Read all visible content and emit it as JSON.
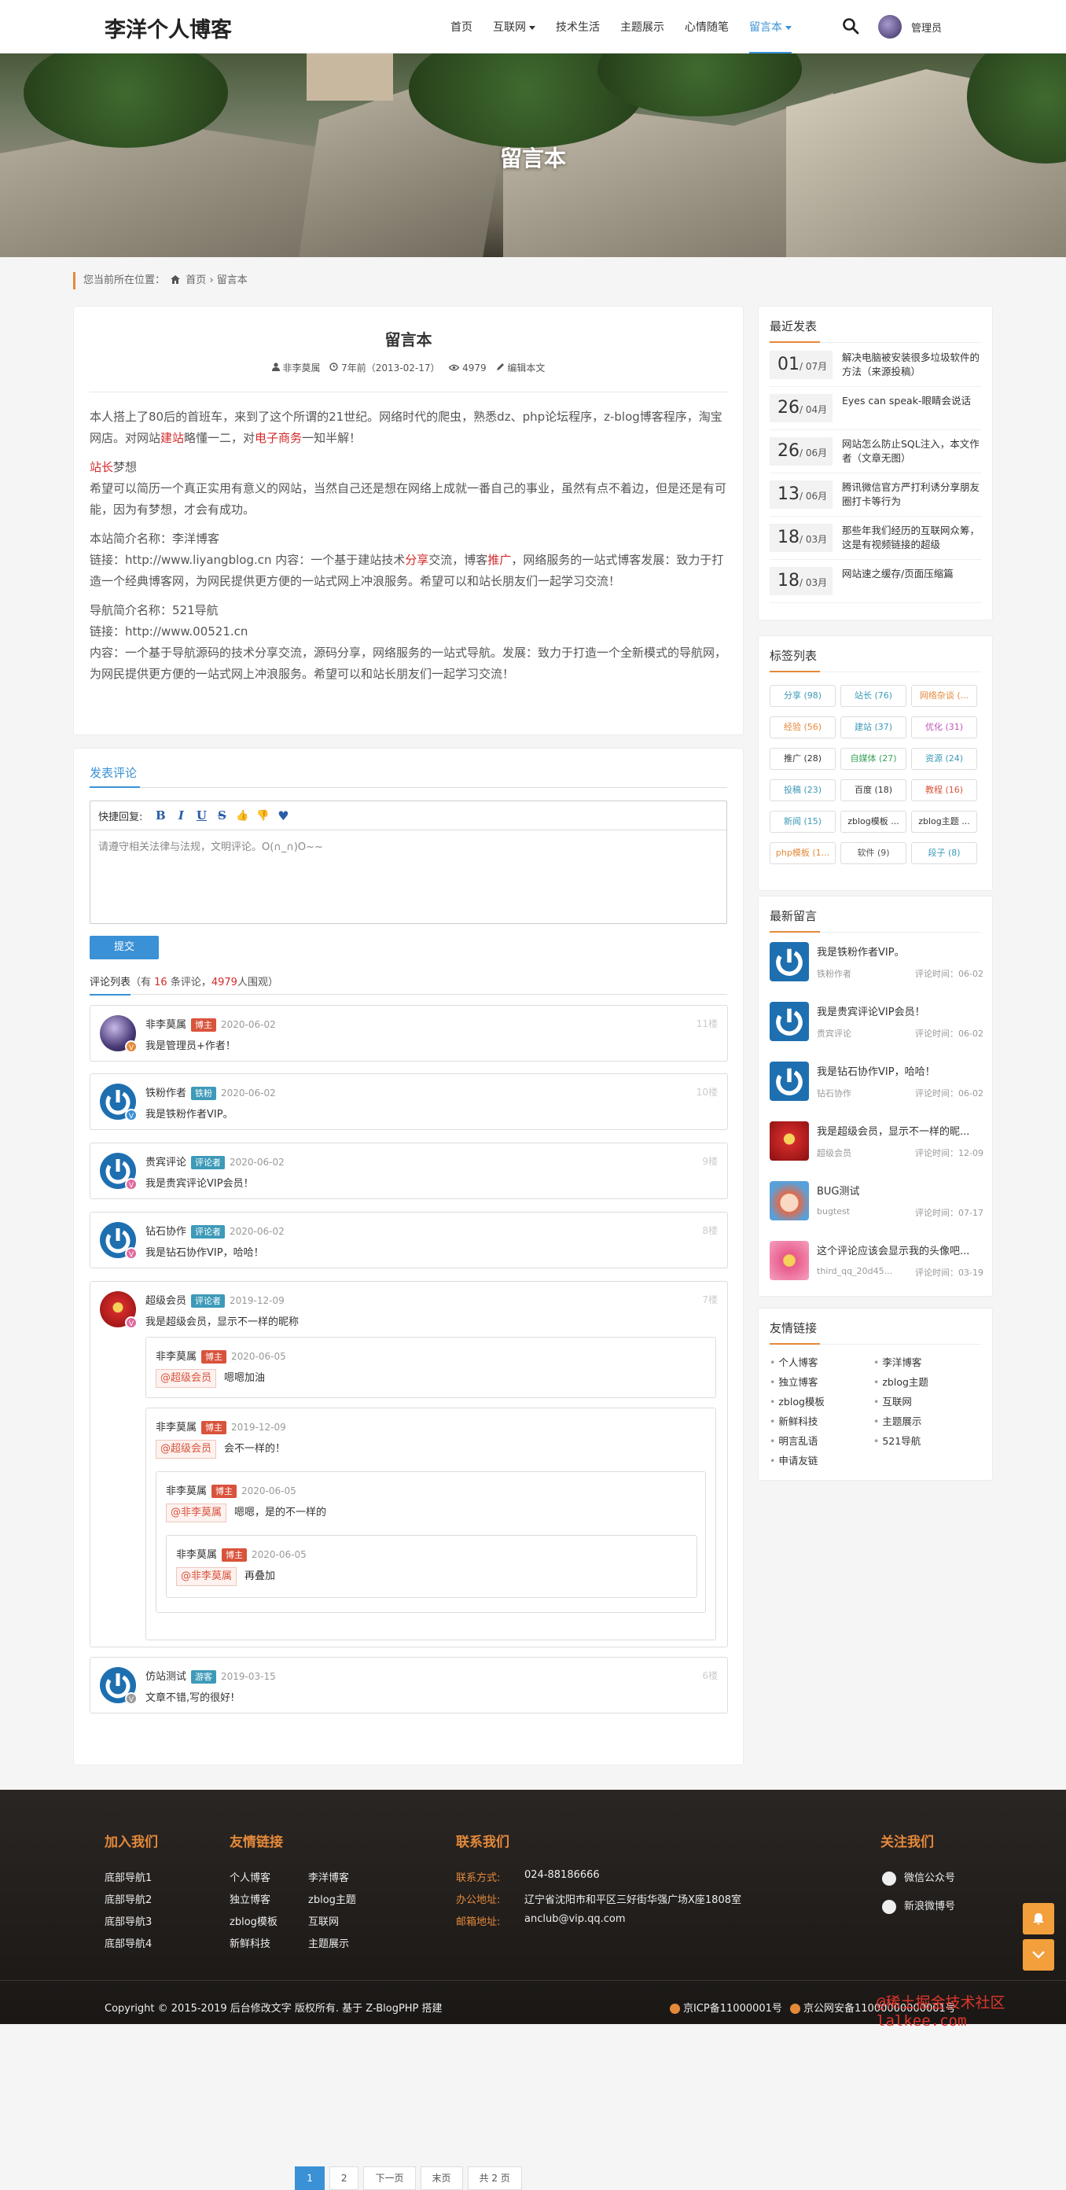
{
  "header": {
    "logo": "李洋个人博客",
    "nav": [
      {
        "label": "首页",
        "caret": false,
        "current": false
      },
      {
        "label": "互联网",
        "caret": true,
        "current": false
      },
      {
        "label": "技术生活",
        "caret": false,
        "current": false
      },
      {
        "label": "主题展示",
        "caret": false,
        "current": false
      },
      {
        "label": "心情随笔",
        "caret": false,
        "current": false
      },
      {
        "label": "留言本",
        "caret": true,
        "current": true
      }
    ],
    "user": "管理员"
  },
  "banner": {
    "title": "留言本"
  },
  "breadcrumb": {
    "prefix": "您当前所在位置：",
    "home": "首页",
    "sep": "›",
    "current": "留言本"
  },
  "article": {
    "title": "留言本",
    "author": "非李莫属",
    "time": "7年前（2013-02-17）",
    "views": "4979",
    "edit": "编辑本文",
    "p1a": "本人搭上了80后的首班车，来到了这个所谓的21世纪。网络时代的爬虫，熟悉dz、php论坛程序，z-blog博客程序，淘宝网店。对网站",
    "p1b": "建站",
    "p1c": "略懂一二，对",
    "p1d": "电子商务",
    "p1e": "一知半解！",
    "p2a": "站长",
    "p2b": "梦想",
    "p2c": "希望可以简历一个真正实用有意义的网站，当然自己还是想在网络上成就一番自己的事业，虽然有点不着边，但是还是有可能，因为有梦想，才会有成功。",
    "p3a": "本站简介名称：李洋博客",
    "p3b": "链接：http://www.liyangblog.cn 内容：一个基于建站技术",
    "p3c": "分享",
    "p3d": "交流，博客",
    "p3e": "推广",
    "p3f": "，网络服务的一站式博客发展：致力于打造一个经典博客网，为网民提供更方便的一站式网上冲浪服务。希望可以和站长朋友们一起学习交流！",
    "p4a": "导航简介名称：521导航",
    "p4b": "链接：http://www.00521.cn",
    "p4c": "内容：一个基于导航源码的技术分享交流，源码分享，网络服务的一站式导航。发展：致力于打造一个全新模式的导航网，为网民提供更方便的一站式网上冲浪服务。希望可以和站长朋友们一起学习交流！"
  },
  "comment_form": {
    "title": "发表评论",
    "quick": "快捷回复:",
    "tools": [
      "B",
      "I",
      "U",
      "S",
      "👍",
      "👎",
      "♥"
    ],
    "placeholder": "请遵守相关法律与法规，文明评论。O(∩_∩)O~~",
    "submit": "提交"
  },
  "comment_list": {
    "label": "评论列表",
    "pre": "（有 ",
    "count": "16",
    "mid": " 条评论，",
    "views": "4979",
    "post": "人围观）"
  },
  "comments": [
    {
      "name": "非李莫属",
      "badge": "博主",
      "badge_color": "#d9533c",
      "date": "2020-06-02",
      "floor": "11楼",
      "text": "我是管理员+作者！",
      "avatar": "anime",
      "vcolor": "#e4893a"
    },
    {
      "name": "铁粉作者",
      "badge": "铁粉",
      "badge_color": "#3d9ab8",
      "date": "2020-06-02",
      "floor": "10楼",
      "text": "我是铁粉作者VIP。",
      "avatar": "logo",
      "vcolor": "#3a91d6"
    },
    {
      "name": "贵宾评论",
      "badge": "评论者",
      "badge_color": "#3d9ab8",
      "date": "2020-06-02",
      "floor": "9楼",
      "text": "我是贵宾评论VIP会员！",
      "avatar": "logo",
      "vcolor": "#e06aa0"
    },
    {
      "name": "钻石协作",
      "badge": "评论者",
      "badge_color": "#3d9ab8",
      "date": "2020-06-02",
      "floor": "8楼",
      "text": "我是钻石协作VIP，哈哈！",
      "avatar": "logo",
      "vcolor": "#e06aa0"
    },
    {
      "name": "超级会员",
      "badge": "评论者",
      "badge_color": "#3d9ab8",
      "date": "2019-12-09",
      "floor": "7楼",
      "text": "我是超级会员，显示不一样的昵称",
      "avatar": "red",
      "vcolor": "#e06aa0"
    },
    {
      "name": "仿站测试",
      "badge": "游客",
      "badge_color": "#3d9ab8",
      "date": "2019-03-15",
      "floor": "6楼",
      "text": "文章不错,写的很好!",
      "avatar": "logo",
      "vcolor": "#999999"
    }
  ],
  "replies": [
    {
      "name": "非李莫属",
      "badge": "博主",
      "date": "2020-06-05",
      "at": "@超级会员",
      "text": "嗯嗯加油"
    },
    {
      "name": "非李莫属",
      "badge": "博主",
      "date": "2019-12-09",
      "at": "@超级会员",
      "text": "会不一样的！"
    },
    {
      "name": "非李莫属",
      "badge": "博主",
      "date": "2020-06-05",
      "at": "@非李莫属",
      "text": "嗯嗯，是的不一样的"
    },
    {
      "name": "非李莫属",
      "badge": "博主",
      "date": "2020-06-05",
      "at": "@非李莫属",
      "text": "再叠加"
    }
  ],
  "pager": [
    "1",
    "2",
    "下一页",
    "末页",
    "共 2 页"
  ],
  "sidebar": {
    "recent_title": "最近发表",
    "recent": [
      {
        "day": "01",
        "mon": "/ 07月",
        "title": "解决电脑被安装很多垃圾软件的方法（来源投稿）"
      },
      {
        "day": "26",
        "mon": "/ 04月",
        "title": "Eyes can speak-眼睛会说话"
      },
      {
        "day": "26",
        "mon": "/ 06月",
        "title": "网站怎么防止SQL注入，本文作者（文章无图）"
      },
      {
        "day": "13",
        "mon": "/ 06月",
        "title": "腾讯微信官方严打利诱分享朋友圈打卡等行为"
      },
      {
        "day": "18",
        "mon": "/ 03月",
        "title": "那些年我们经历的互联网众筹，这是有视频链接的超级"
      },
      {
        "day": "18",
        "mon": "/ 03月",
        "title": "网站速之缓存/页面压缩篇"
      }
    ],
    "tags_title": "标签列表",
    "tags": [
      {
        "label": "分享 (98)",
        "color": "#3d9ab8"
      },
      {
        "label": "站长 (76)",
        "color": "#3d9ab8"
      },
      {
        "label": "网络杂谈 (...",
        "color": "#e4893a"
      },
      {
        "label": "经验 (56)",
        "color": "#e4893a"
      },
      {
        "label": "建站 (37)",
        "color": "#3d9ab8"
      },
      {
        "label": "优化 (31)",
        "color": "#c054b7"
      },
      {
        "label": "推广 (28)",
        "color": "#333333"
      },
      {
        "label": "自媒体 (27)",
        "color": "#3aa35a"
      },
      {
        "label": "资源 (24)",
        "color": "#3d9ab8"
      },
      {
        "label": "投稿 (23)",
        "color": "#3d9ab8"
      },
      {
        "label": "百度 (18)",
        "color": "#333333"
      },
      {
        "label": "教程 (16)",
        "color": "#d9533c"
      },
      {
        "label": "新闻 (15)",
        "color": "#3d9ab8"
      },
      {
        "label": "zblog模板 ...",
        "color": "#333333"
      },
      {
        "label": "zblog主题 ...",
        "color": "#333333"
      },
      {
        "label": "php模板 (1...",
        "color": "#e4893a"
      },
      {
        "label": "软件 (9)",
        "color": "#555555"
      },
      {
        "label": "段子 (8)",
        "color": "#3d9ab8"
      }
    ],
    "msg_title": "最新留言",
    "msgs": [
      {
        "text": "我是铁粉作者VIP。",
        "user": "铁粉作者",
        "time": "评论时间：06-02",
        "avatar": "logo"
      },
      {
        "text": "我是贵宾评论VIP会员！",
        "user": "贵宾评论",
        "time": "评论时间：06-02",
        "avatar": "logo"
      },
      {
        "text": "我是钻石协作VIP，哈哈！",
        "user": "钻石协作",
        "time": "评论时间：06-02",
        "avatar": "logo"
      },
      {
        "text": "我是超级会员，显示不一样的昵...",
        "user": "超级会员",
        "time": "评论时间：12-09",
        "avatar": "red"
      },
      {
        "text": "BUG测试",
        "user": "bugtest",
        "time": "评论时间：07-17",
        "avatar": "doll"
      },
      {
        "text": "这个评论应该会显示我的头像吧...",
        "user": "third_qq_20d45...",
        "time": "评论时间：03-19",
        "avatar": "pink"
      }
    ],
    "links_title": "友情链接",
    "links": [
      "个人博客",
      "李洋博客",
      "独立博客",
      "zblog主题",
      "zblog模板",
      "互联网",
      "新鲜科技",
      "主题展示",
      "明言乱语",
      "521导航",
      "申请友链"
    ]
  },
  "footer": {
    "join_title": "加入我们",
    "join": [
      "底部导航1",
      "底部导航2",
      "底部导航3",
      "底部导航4"
    ],
    "links_title": "友情链接",
    "links": [
      "个人博客",
      "李洋博客",
      "独立博客",
      "zblog主题",
      "zblog模板",
      "互联网",
      "新鲜科技",
      "主题展示"
    ],
    "contact_title": "联系我们",
    "contact": [
      {
        "k": "联系方式:",
        "v": "024-88186666"
      },
      {
        "k": "办公地址:",
        "v": "辽宁省沈阳市和平区三好街华强广场X座1808室"
      },
      {
        "k": "邮箱地址:",
        "v": "anclub@vip.qq.com"
      }
    ],
    "follow_title": "关注我们",
    "follow": [
      "微信公众号",
      "新浪微博号"
    ],
    "copyright": "Copyright © 2015-2019 后台修改文字 版权所有. 基于 Z-BlogPHP 搭建",
    "icp1": "京ICP备11000001号",
    "icp2": "京公网安备11000000000001号",
    "watermark": "@稀土掘金技术社区 lalkee.com"
  }
}
